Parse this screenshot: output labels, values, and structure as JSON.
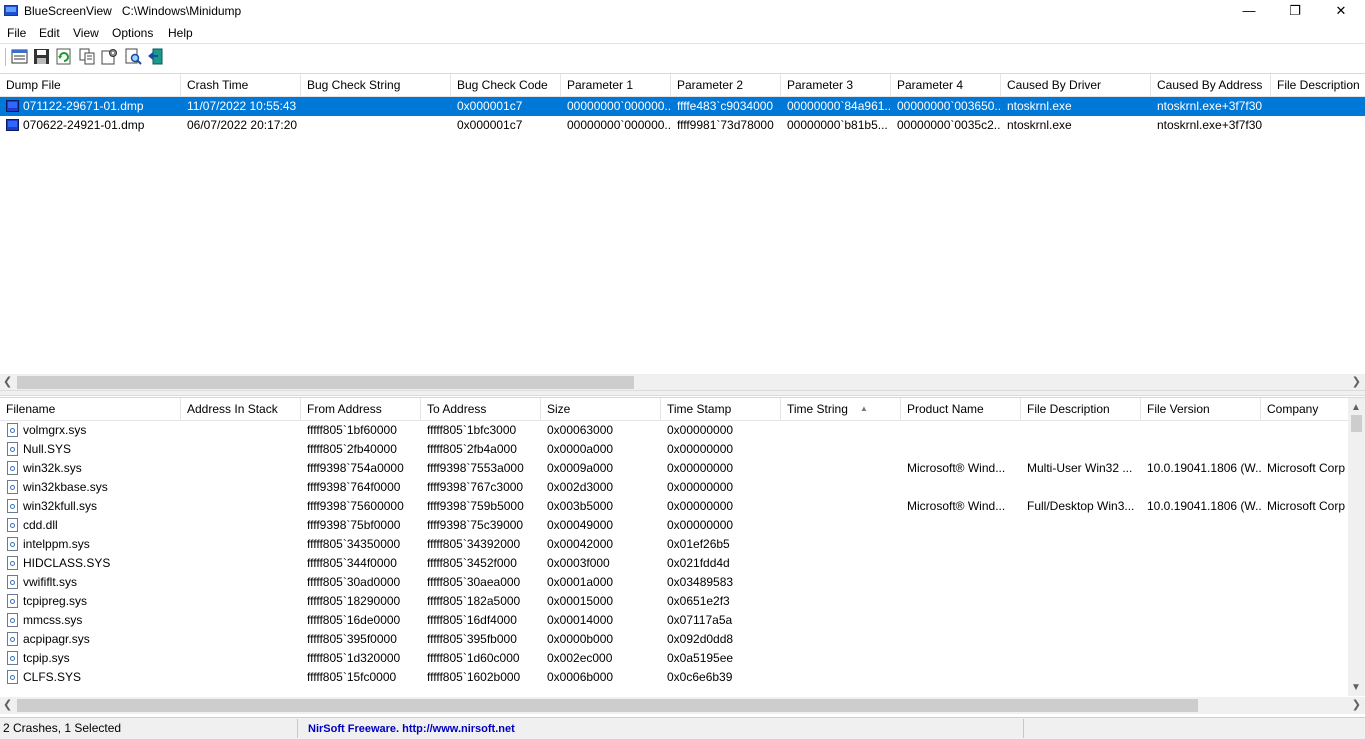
{
  "window": {
    "app_name": "BlueScreenView",
    "path": "C:\\Windows\\Minidump",
    "minimize": "—",
    "maximize": "❐",
    "close": "✕"
  },
  "menu": [
    "File",
    "Edit",
    "View",
    "Options",
    "Help"
  ],
  "toolbar": [
    "properties-icon",
    "save-icon",
    "refresh-icon",
    "copy-icon",
    "options-icon",
    "find-icon",
    "exit-icon"
  ],
  "crash_list": {
    "columns": [
      "Dump File",
      "Crash Time",
      "Bug Check String",
      "Bug Check Code",
      "Parameter 1",
      "Parameter 2",
      "Parameter 3",
      "Parameter 4",
      "Caused By Driver",
      "Caused By Address",
      "File Description"
    ],
    "rows": [
      [
        "071122-29671-01.dmp",
        "11/07/2022 10:55:43",
        "",
        "0x000001c7",
        "00000000`000000...",
        "ffffe483`c9034000",
        "00000000`84a961...",
        "00000000`003650...",
        "ntoskrnl.exe",
        "ntoskrnl.exe+3f7f30",
        ""
      ],
      [
        "070622-24921-01.dmp",
        "06/07/2022 20:17:20",
        "",
        "0x000001c7",
        "00000000`000000...",
        "ffff9981`73d78000",
        "00000000`b81b5...",
        "00000000`0035c2...",
        "ntoskrnl.exe",
        "ntoskrnl.exe+3f7f30",
        ""
      ]
    ],
    "selected_row": 0
  },
  "driver_list": {
    "columns": [
      "Filename",
      "Address In Stack",
      "From Address",
      "To Address",
      "Size",
      "Time Stamp",
      "Time String",
      "Product Name",
      "File Description",
      "File Version",
      "Company"
    ],
    "rows": [
      [
        "volmgrx.sys",
        "",
        "fffff805`1bf60000",
        "fffff805`1bfc3000",
        "0x00063000",
        "0x00000000",
        "",
        "",
        "",
        "",
        ""
      ],
      [
        "Null.SYS",
        "",
        "fffff805`2fb40000",
        "fffff805`2fb4a000",
        "0x0000a000",
        "0x00000000",
        "",
        "",
        "",
        "",
        ""
      ],
      [
        "win32k.sys",
        "",
        "ffff9398`754a0000",
        "ffff9398`7553a000",
        "0x0009a000",
        "0x00000000",
        "",
        "Microsoft® Wind...",
        "Multi-User Win32 ...",
        "10.0.19041.1806 (W...",
        "Microsoft Corp"
      ],
      [
        "win32kbase.sys",
        "",
        "ffff9398`764f0000",
        "ffff9398`767c3000",
        "0x002d3000",
        "0x00000000",
        "",
        "",
        "",
        "",
        ""
      ],
      [
        "win32kfull.sys",
        "",
        "ffff9398`75600000",
        "ffff9398`759b5000",
        "0x003b5000",
        "0x00000000",
        "",
        "Microsoft® Wind...",
        "Full/Desktop Win3...",
        "10.0.19041.1806 (W...",
        "Microsoft Corp"
      ],
      [
        "cdd.dll",
        "",
        "ffff9398`75bf0000",
        "ffff9398`75c39000",
        "0x00049000",
        "0x00000000",
        "",
        "",
        "",
        "",
        ""
      ],
      [
        "intelppm.sys",
        "",
        "fffff805`34350000",
        "fffff805`34392000",
        "0x00042000",
        "0x01ef26b5",
        "",
        "",
        "",
        "",
        ""
      ],
      [
        "HIDCLASS.SYS",
        "",
        "fffff805`344f0000",
        "fffff805`3452f000",
        "0x0003f000",
        "0x021fdd4d",
        "",
        "",
        "",
        "",
        ""
      ],
      [
        "vwififlt.sys",
        "",
        "fffff805`30ad0000",
        "fffff805`30aea000",
        "0x0001a000",
        "0x03489583",
        "",
        "",
        "",
        "",
        ""
      ],
      [
        "tcpipreg.sys",
        "",
        "fffff805`18290000",
        "fffff805`182a5000",
        "0x00015000",
        "0x0651e2f3",
        "",
        "",
        "",
        "",
        ""
      ],
      [
        "mmcss.sys",
        "",
        "fffff805`16de0000",
        "fffff805`16df4000",
        "0x00014000",
        "0x07117a5a",
        "",
        "",
        "",
        "",
        ""
      ],
      [
        "acpipagr.sys",
        "",
        "fffff805`395f0000",
        "fffff805`395fb000",
        "0x0000b000",
        "0x092d0dd8",
        "",
        "",
        "",
        "",
        ""
      ],
      [
        "tcpip.sys",
        "",
        "fffff805`1d320000",
        "fffff805`1d60c000",
        "0x002ec000",
        "0x0a5195ee",
        "",
        "",
        "",
        "",
        ""
      ],
      [
        "CLFS.SYS",
        "",
        "fffff805`15fc0000",
        "fffff805`1602b000",
        "0x0006b000",
        "0x0c6e6b39",
        "",
        "",
        "",
        "",
        ""
      ]
    ]
  },
  "status": {
    "summary": "2 Crashes, 1 Selected",
    "link": "NirSoft Freeware.  http://www.nirsoft.net"
  },
  "colors": {
    "selection": "#0078d7",
    "link": "#0000c0"
  }
}
